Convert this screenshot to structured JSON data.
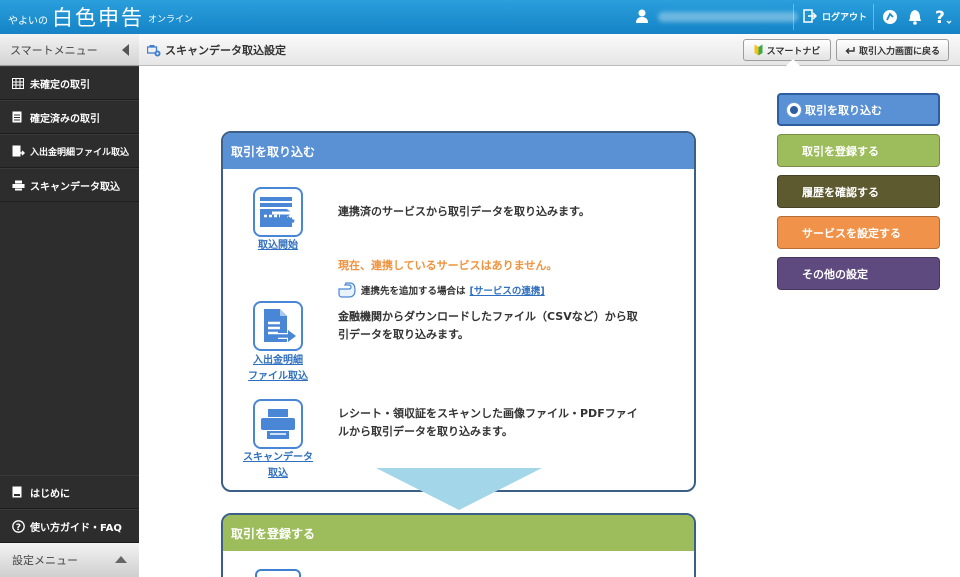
{
  "topbar": {
    "logo_small": "やよいの",
    "logo_big": "白色申告",
    "logo_suffix": "オンライン",
    "logout_label": "ログアウト",
    "icons": [
      "user-icon",
      "logout-icon",
      "guide-icon",
      "bell-icon",
      "help-icon"
    ]
  },
  "sidebar": {
    "header": "スマートメニュー",
    "items": [
      {
        "label": "未確定の取引",
        "icon": "columns-icon"
      },
      {
        "label": "確定済みの取引",
        "icon": "document-icon"
      },
      {
        "label": "入出金明細ファイル取込",
        "icon": "file-import-icon"
      },
      {
        "label": "スキャンデータ取込",
        "icon": "scanner-icon"
      }
    ],
    "bottom_items": [
      {
        "label": "はじめに",
        "icon": "book-icon"
      },
      {
        "label": "使い方ガイド・FAQ",
        "icon": "question-icon"
      }
    ],
    "settings_menu": "設定メニュー"
  },
  "subheader": {
    "title": "スキャンデータ取込設定",
    "smart_navi": "スマートナビ",
    "back_button": "取引入力画面に戻る"
  },
  "panel": {
    "header": "取引を取り込む",
    "features": [
      {
        "link": "取込開始",
        "description": "連携済のサービスから取引データを取り込みます。"
      },
      {
        "link_lines": [
          "入出金明細",
          "ファイル取込"
        ],
        "description_lines": [
          "金融機関からダウンロードしたファイル（CSVなど）から取",
          "引データを取り込みます。"
        ]
      },
      {
        "link_lines": [
          "スキャンデータ",
          "取込"
        ],
        "description_lines": [
          "レシート・領収証をスキャンした画像ファイル・PDFファイ",
          "ルから取引データを取り込みます。"
        ]
      }
    ],
    "notice": "現在、連携しているサービスはありません。",
    "hint_text": "連携先を追加する場合は",
    "hint_link": "[サービスの連携]"
  },
  "panel2": {
    "header": "取引を登録する"
  },
  "right_nav": [
    {
      "label": "取引を取り込む",
      "color": "#5a90d4",
      "active": true
    },
    {
      "label": "取引を登録する",
      "color": "#9dbd5c",
      "active": false
    },
    {
      "label": "履歴を確認する",
      "color": "#5e5a30",
      "active": false
    },
    {
      "label": "サービスを設定する",
      "color": "#f0924a",
      "active": false
    },
    {
      "label": "その他の設定",
      "color": "#5e4a7e",
      "active": false
    }
  ]
}
